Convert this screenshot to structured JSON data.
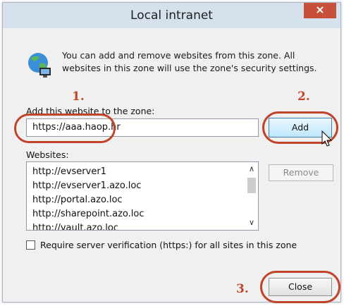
{
  "window": {
    "title": "Local intranet",
    "close_glyph": "×"
  },
  "intro": {
    "icon": "globe-network-icon",
    "text": "You can add and remove websites from this zone. All websites in this zone will use the zone's security settings."
  },
  "annotations": [
    "1.",
    "2.",
    "3."
  ],
  "add_section": {
    "label": "Add this website to the zone:",
    "input_value": "https://aaa.haop.hr",
    "add_label": "Add"
  },
  "websites": {
    "label": "Websites:",
    "items": [
      "http://evserver1",
      "http://evserver1.azo.loc",
      "http://portal.azo.loc",
      "http://sharepoint.azo.loc",
      "http://vault.azo.loc"
    ],
    "remove_label": "Remove"
  },
  "options": {
    "require_https_label": "Require server verification (https:) for all sites in this zone",
    "require_https_checked": false
  },
  "footer": {
    "close_label": "Close"
  },
  "colors": {
    "annotation": "#c0442a",
    "close_button": "#c7503d",
    "titlebar": "#d6e1ee"
  }
}
